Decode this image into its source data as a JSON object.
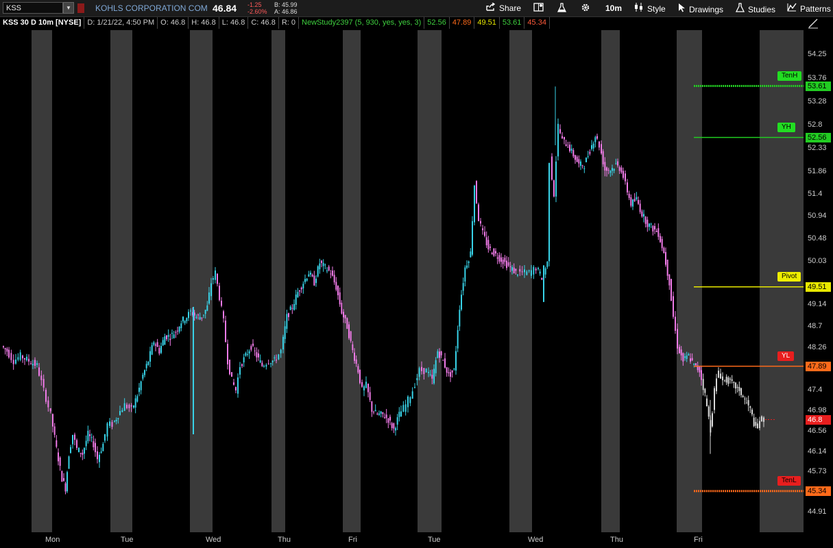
{
  "header": {
    "symbol": "KSS",
    "company": "KOHLS CORPORATION COM",
    "last": "46.84",
    "change": "-1.25",
    "change_pct": "-2.60%",
    "bid": "B: 45.99",
    "ask": "A: 46.86",
    "toolbar": {
      "share": "Share",
      "timeframe": "10m",
      "style": "Style",
      "drawings": "Drawings",
      "studies": "Studies",
      "patterns": "Patterns"
    }
  },
  "info": {
    "title": "KSS 30 D 10m [NYSE]",
    "date": "D: 1/21/22, 4:50 PM",
    "open": "O: 46.8",
    "high": "H: 46.8",
    "low": "L: 46.8",
    "close": "C: 46.8",
    "range": "R: 0",
    "study": "NewStudy2397 (5, 930, yes, yes, 3)",
    "v1": "52.56",
    "v2": "47.89",
    "v3": "49.51",
    "v4": "53.61",
    "v5": "45.34"
  },
  "colors": {
    "up": "#38d3e8",
    "down": "#f07be8",
    "neutral": "#d8d8d8",
    "session_shade": "#3a3a3a",
    "tenh": "#22cc22",
    "yh": "#22cc22",
    "pivot": "#e8e800",
    "yl": "#ff6a1a",
    "tenl": "#ff6a1a"
  },
  "chart_data": {
    "type": "candlestick",
    "ylim": [
      44.5,
      54.75
    ],
    "y_ticks": [
      "54.25",
      "53.76",
      "53.28",
      "52.8",
      "52.33",
      "51.86",
      "51.4",
      "50.94",
      "50.48",
      "50.03",
      "49.14",
      "48.7",
      "48.26",
      "47.4",
      "46.98",
      "46.56",
      "46.14",
      "45.73",
      "44.91"
    ],
    "x_ticks": [
      "Mon",
      "Tue",
      "Wed",
      "Thu",
      "Fri",
      "Tue",
      "Wed",
      "Thu",
      "Fri"
    ],
    "last_price_label": "46.8",
    "levels": [
      {
        "name": "TenH",
        "value": 53.61,
        "label": "53.61",
        "color": "#22cc22"
      },
      {
        "name": "YH",
        "value": 52.56,
        "label": "52.56",
        "color": "#22cc22"
      },
      {
        "name": "Pivot",
        "value": 49.51,
        "label": "49.51",
        "color": "#e8e800"
      },
      {
        "name": "YL",
        "value": 47.89,
        "label": "47.89",
        "color": "#ff6a1a"
      },
      {
        "name": "TenL",
        "value": 45.34,
        "label": "45.34",
        "color": "#ff6a1a"
      }
    ],
    "price_path": [
      [
        0,
        48.3
      ],
      [
        8,
        48.2
      ],
      [
        18,
        48.0
      ],
      [
        28,
        48.1
      ],
      [
        40,
        48.0
      ],
      [
        52,
        47.9
      ],
      [
        62,
        47.4
      ],
      [
        72,
        46.9
      ],
      [
        80,
        46.2
      ],
      [
        88,
        45.6
      ],
      [
        93,
        45.4
      ],
      [
        98,
        46.1
      ],
      [
        104,
        46.5
      ],
      [
        110,
        46.2
      ],
      [
        118,
        46.1
      ],
      [
        126,
        46.5
      ],
      [
        134,
        46.3
      ],
      [
        140,
        46.0
      ],
      [
        148,
        46.3
      ],
      [
        155,
        46.7
      ],
      [
        162,
        46.7
      ],
      [
        170,
        46.9
      ],
      [
        180,
        47.1
      ],
      [
        190,
        47.0
      ],
      [
        198,
        47.3
      ],
      [
        206,
        47.7
      ],
      [
        214,
        48.0
      ],
      [
        222,
        48.4
      ],
      [
        230,
        48.2
      ],
      [
        238,
        48.5
      ],
      [
        246,
        48.5
      ],
      [
        254,
        48.6
      ],
      [
        262,
        48.8
      ],
      [
        270,
        48.9
      ],
      [
        276,
        49.0
      ],
      [
        284,
        48.9
      ],
      [
        292,
        48.9
      ],
      [
        300,
        49.1
      ],
      [
        306,
        49.6
      ],
      [
        312,
        49.8
      ],
      [
        318,
        49.3
      ],
      [
        324,
        48.8
      ],
      [
        330,
        48.0
      ],
      [
        336,
        47.6
      ],
      [
        342,
        47.4
      ],
      [
        348,
        47.9
      ],
      [
        356,
        48.1
      ],
      [
        364,
        48.3
      ],
      [
        372,
        48.1
      ],
      [
        380,
        47.9
      ],
      [
        390,
        48.0
      ],
      [
        398,
        48.0
      ],
      [
        408,
        48.2
      ],
      [
        416,
        48.9
      ],
      [
        424,
        49.1
      ],
      [
        432,
        49.4
      ],
      [
        440,
        49.6
      ],
      [
        448,
        49.8
      ],
      [
        456,
        49.6
      ],
      [
        464,
        50.0
      ],
      [
        472,
        49.9
      ],
      [
        480,
        49.8
      ],
      [
        488,
        49.5
      ],
      [
        496,
        49.0
      ],
      [
        504,
        48.7
      ],
      [
        512,
        48.2
      ],
      [
        520,
        47.8
      ],
      [
        526,
        47.4
      ],
      [
        532,
        47.5
      ],
      [
        540,
        47.0
      ],
      [
        548,
        46.9
      ],
      [
        556,
        46.9
      ],
      [
        564,
        46.8
      ],
      [
        572,
        46.6
      ],
      [
        580,
        46.9
      ],
      [
        590,
        47.1
      ],
      [
        600,
        47.4
      ],
      [
        610,
        47.8
      ],
      [
        620,
        47.8
      ],
      [
        628,
        47.6
      ],
      [
        636,
        48.2
      ],
      [
        644,
        48.0
      ],
      [
        652,
        47.7
      ],
      [
        660,
        47.8
      ],
      [
        668,
        49.1
      ],
      [
        676,
        49.9
      ],
      [
        684,
        50.2
      ],
      [
        690,
        51.6
      ],
      [
        696,
        50.9
      ],
      [
        702,
        50.6
      ],
      [
        710,
        50.3
      ],
      [
        718,
        50.2
      ],
      [
        726,
        50.1
      ],
      [
        734,
        50.0
      ],
      [
        742,
        49.9
      ],
      [
        750,
        49.8
      ],
      [
        760,
        49.8
      ],
      [
        770,
        49.8
      ],
      [
        780,
        49.9
      ],
      [
        788,
        49.7
      ],
      [
        796,
        50.0
      ],
      [
        800,
        52.1
      ],
      [
        806,
        51.4
      ],
      [
        812,
        52.8
      ],
      [
        818,
        52.5
      ],
      [
        826,
        52.4
      ],
      [
        834,
        52.2
      ],
      [
        842,
        52.0
      ],
      [
        850,
        52.0
      ],
      [
        858,
        52.3
      ],
      [
        866,
        52.6
      ],
      [
        872,
        52.4
      ],
      [
        880,
        51.9
      ],
      [
        888,
        51.9
      ],
      [
        896,
        52.0
      ],
      [
        904,
        51.9
      ],
      [
        910,
        51.6
      ],
      [
        918,
        51.2
      ],
      [
        926,
        51.3
      ],
      [
        934,
        51.0
      ],
      [
        942,
        50.8
      ],
      [
        950,
        50.7
      ],
      [
        958,
        50.6
      ],
      [
        966,
        50.2
      ],
      [
        974,
        49.6
      ],
      [
        980,
        48.9
      ],
      [
        986,
        48.3
      ],
      [
        994,
        48.0
      ],
      [
        1002,
        48.1
      ],
      [
        1010,
        47.9
      ],
      [
        1018,
        47.8
      ],
      [
        1026,
        47.3
      ],
      [
        1034,
        46.6
      ],
      [
        1040,
        47.4
      ],
      [
        1046,
        47.8
      ],
      [
        1052,
        47.6
      ],
      [
        1060,
        47.6
      ],
      [
        1068,
        47.5
      ],
      [
        1076,
        47.4
      ],
      [
        1084,
        47.2
      ],
      [
        1092,
        47.0
      ],
      [
        1100,
        46.6
      ],
      [
        1106,
        46.8
      ],
      [
        1112,
        46.8
      ]
    ]
  }
}
